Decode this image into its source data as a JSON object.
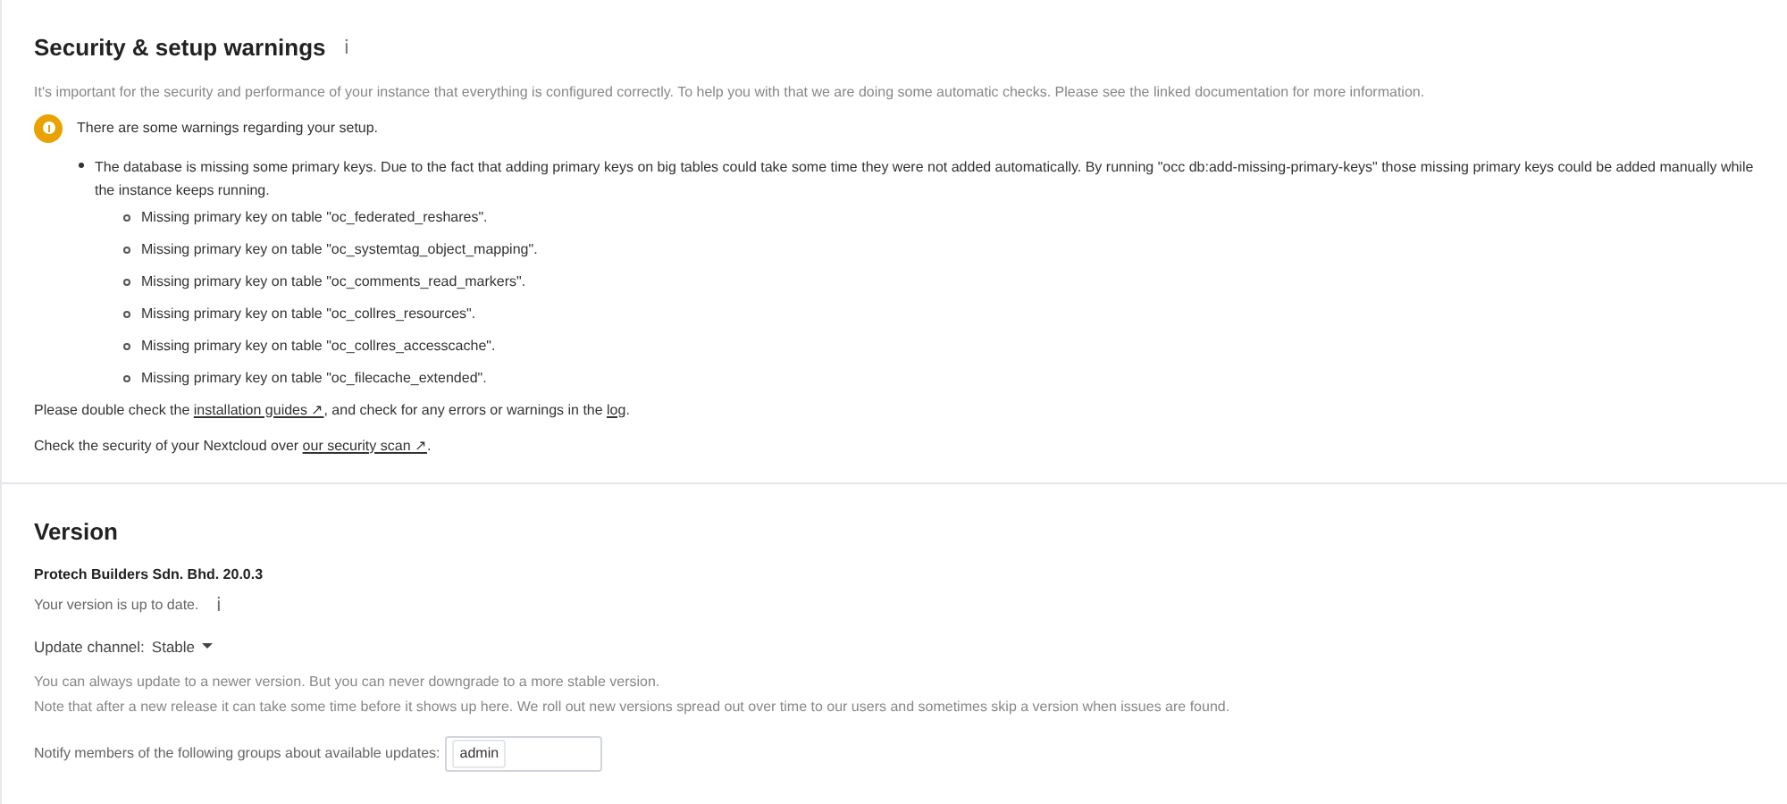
{
  "security": {
    "title": "Security & setup warnings",
    "info_icon": "ℹ",
    "intro": "It's important for the security and performance of your instance that everything is configured correctly. To help you with that we are doing some automatic checks. Please see the linked documentation for more information.",
    "warning": "There are some warnings regarding your setup.",
    "issue": "The database is missing some primary keys. Due to the fact that adding primary keys on big tables could take some time they were not added automatically. By running \"occ db:add-missing-primary-keys\" those missing primary keys could be added manually while the instance keeps running.",
    "missing": [
      "Missing primary key on table \"oc_federated_reshares\".",
      "Missing primary key on table \"oc_systemtag_object_mapping\".",
      "Missing primary key on table \"oc_comments_read_markers\".",
      "Missing primary key on table \"oc_collres_resources\".",
      "Missing primary key on table \"oc_collres_accesscache\".",
      "Missing primary key on table \"oc_filecache_extended\"."
    ],
    "footer": [
      [
        {
          "text": "Please double check the "
        },
        {
          "text": "installation guides ↗",
          "link": true
        },
        {
          "text": ", and check for any errors or warnings in the "
        },
        {
          "text": "log",
          "link": true
        },
        {
          "text": "."
        }
      ],
      [
        {
          "text": "Check the security of your Nextcloud over "
        },
        {
          "text": "our security scan ↗",
          "link": true
        },
        {
          "text": "."
        }
      ]
    ]
  },
  "version": {
    "title": "Version",
    "product": "Protech Builders Sdn. Bhd. 20.0.3",
    "status": "Your version is up to date.",
    "info_icon": "ℹ",
    "channel_label": "Update channel:",
    "channel_value": "Stable",
    "notes": [
      "You can always update to a newer version. But you can never downgrade to a more stable version.",
      "Note that after a new release it can take some time before it shows up here. We roll out new versions spread out over time to our users and sometimes skip a version when issues are found."
    ],
    "notify_label": "Notify members of the following groups about available updates:",
    "groups": [
      "admin"
    ]
  }
}
